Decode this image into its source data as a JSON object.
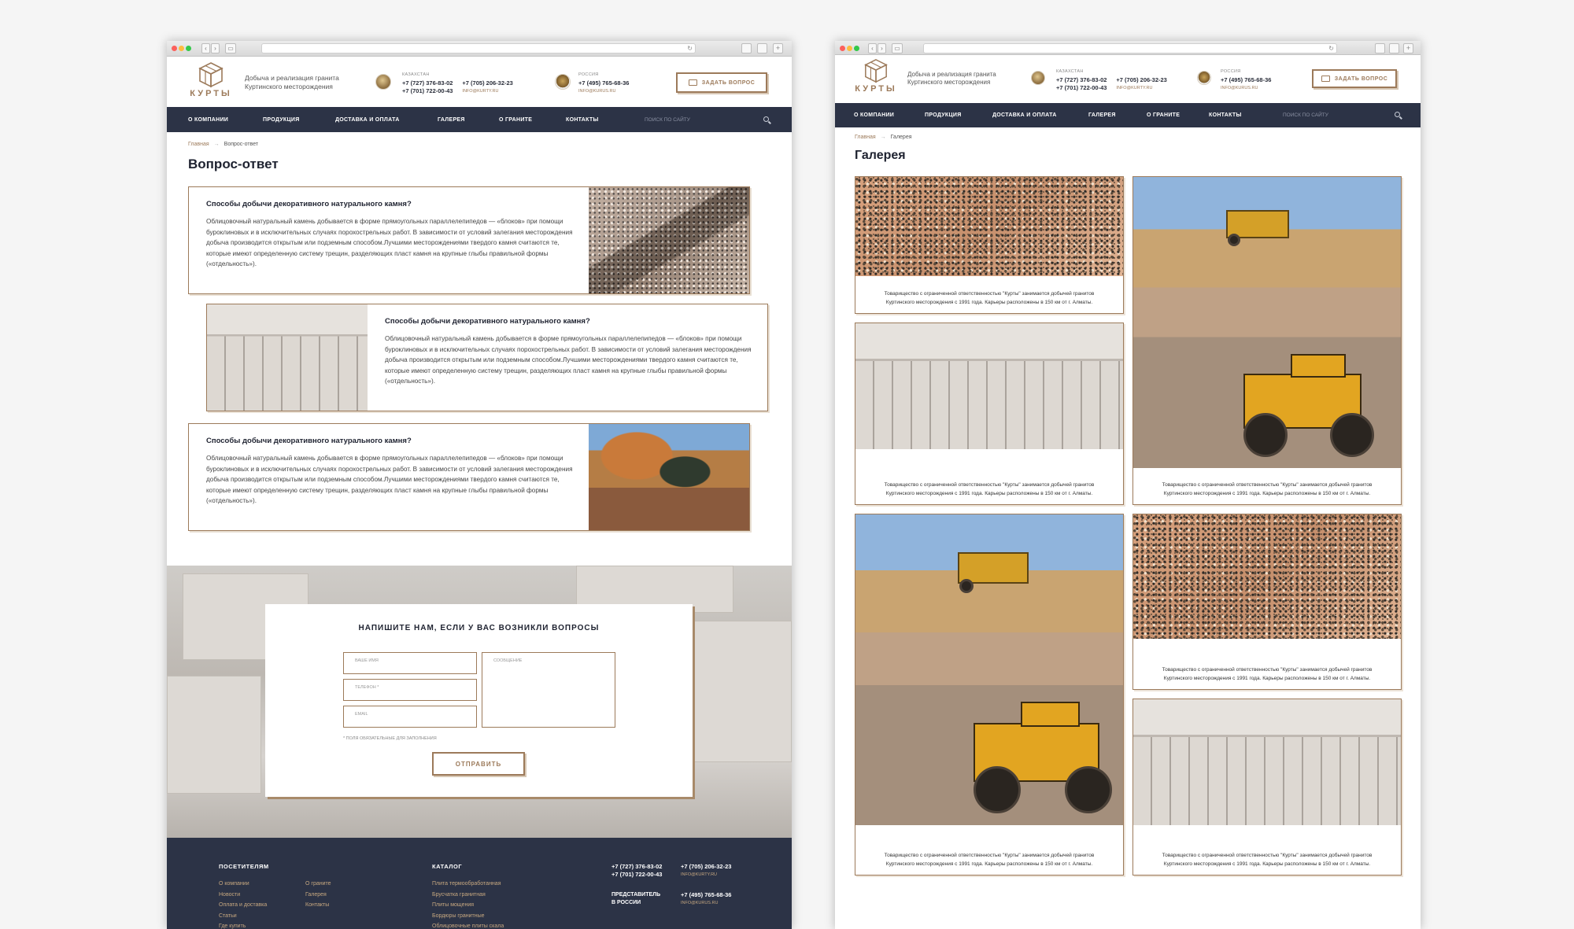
{
  "colors": {
    "accent": "#9c7a5a",
    "nav_bg": "#2c3346",
    "page_bg": "#f5f5f5"
  },
  "site": {
    "logo_text": "КУРТЫ",
    "tagline_1": "Добыча и реализация гранита",
    "tagline_2": "Куртинского месторождения",
    "kz_caption": "КАЗАХСТАН",
    "kz_phone_1": "+7 (727) 376-83-02",
    "kz_phone_2": "+7 (701) 722-00-43",
    "kz_phone_3": "+7 (705) 206-32-23",
    "kz_email": "INFO@KURTY.RU",
    "ru_caption": "РОССИЯ",
    "ru_phone": "+7 (495) 765-68-36",
    "ru_email": "INFO@KURUS.RU",
    "ask_button": "ЗАДАТЬ ВОПРОС",
    "nav": [
      "О КОМПАНИИ",
      "ПРОДУКЦИЯ",
      "ДОСТАВКА И ОПЛАТА",
      "ГАЛЕРЕЯ",
      "О ГРАНИТЕ",
      "КОНТАКТЫ"
    ],
    "search_placeholder": "ПОИСК ПО САЙТУ"
  },
  "faq_page": {
    "breadcrumb_home": "Главная",
    "breadcrumb_sep": "→",
    "breadcrumb_current": "Вопрос-ответ",
    "title": "Вопрос-ответ",
    "items": [
      {
        "question": "Способы добычи декоративного натурального камня?",
        "answer": "Облицовочный натуральный камень добывается в форме прямоугольных параллелепипедов — «блоков» при помощи буроклиновых и в исключительных случаях порохострельных работ. В зависимости от условий залегания месторождения добыча производится открытым или подземным способом.Лучшими месторождениями твердого камня считаются те, которые имеют определенную систему трещин, разделяющих пласт камня на крупные глыбы правильной формы («отдельность»)."
      },
      {
        "question": "Способы добычи декоративного натурального камня?",
        "answer": "Облицовочный натуральный камень добывается в форме прямоугольных параллелепипедов — «блоков» при помощи буроклиновых и в исключительных случаях порохострельных работ. В зависимости от условий залегания месторождения добыча производится открытым или подземным способом.Лучшими месторождениями твердого камня считаются те, которые имеют определенную систему трещин, разделяющих пласт камня на крупные глыбы правильной формы («отдельность»)."
      },
      {
        "question": "Способы добычи декоративного натурального камня?",
        "answer": "Облицовочный натуральный камень добывается в форме прямоугольных параллелепипедов — «блоков» при помощи буроклиновых и в исключительных случаях порохострельных работ. В зависимости от условий залегания месторождения добыча производится открытым или подземным способом.Лучшими месторождениями твердого камня считаются те, которые имеют определенную систему трещин, разделяющих пласт камня на крупные глыбы правильной формы («отдельность»)."
      }
    ],
    "form": {
      "title": "НАПИШИТЕ НАМ, ЕСЛИ У ВАС ВОЗНИКЛИ ВОПРОСЫ",
      "name_placeholder": "ВАШЕ ИМЯ",
      "phone_placeholder": "ТЕЛЕФОН *",
      "email_placeholder": "EMAIL",
      "message_placeholder": "СООБЩЕНИЕ",
      "required_note": "* ПОЛЯ ОБЯЗАТЕЛЬНЫЕ ДЛЯ ЗАПОЛНЕНИЯ",
      "submit": "ОТПРАВИТЬ"
    },
    "footer": {
      "visitors_heading": "ПОСЕТИТЕЛЯМ",
      "visitors_col1": [
        "О компании",
        "Новости",
        "Оплата и доставка",
        "Статьи",
        "Где купить"
      ],
      "visitors_col2": [
        "О граните",
        "Галерея",
        "Контакты"
      ],
      "catalog_heading": "КАТАЛОГ",
      "catalog_items": [
        "Плита термообработанная",
        "Брусчатка гранитная",
        "Плиты мощения",
        "Бордюры гранитные",
        "Облицовочные плиты скала"
      ],
      "phone_1": "+7 (727) 376-83-02",
      "phone_2": "+7 (701) 722-00-43",
      "phone_3": "+7 (705) 206-32-23",
      "email_1": "INFO@KURTY.RU",
      "ru_rep_1": "ПРЕДСТАВИТЕЛЬ",
      "ru_rep_2": "В РОССИИ",
      "ru_phone": "+7 (495) 765-68-36",
      "ru_email": "INFO@KURUS.RU"
    }
  },
  "gallery_page": {
    "breadcrumb_home": "Главная",
    "breadcrumb_sep": "→",
    "breadcrumb_current": "Галерея",
    "title": "Галерея",
    "caption": "Товарищество с ограниченной ответственностью \"Курты\" занимается добычей гранитов Куртинского месторождения с 1991 года. Карьеры расположены в 150 км от г. Алматы."
  }
}
